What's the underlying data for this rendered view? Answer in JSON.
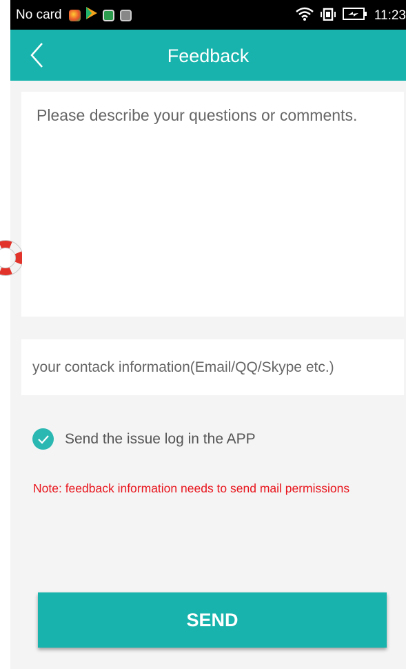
{
  "status_bar": {
    "carrier": "No card",
    "time": "11:23",
    "icons": [
      "app-icon",
      "play-store-icon",
      "app-icon",
      "image-icon",
      "wifi-icon",
      "vibrate-icon",
      "battery-icon"
    ]
  },
  "header": {
    "title": "Feedback",
    "back_icon": "chevron-left-icon"
  },
  "form": {
    "description_placeholder": "Please describe your questions or comments.",
    "description_value": "",
    "contact_placeholder": "your contack information(Email/QQ/Skype etc.)",
    "contact_value": "",
    "send_log_label": "Send the issue log in the APP",
    "send_log_checked": true,
    "note": "Note: feedback information needs to send mail permissions",
    "send_label": "SEND"
  },
  "colors": {
    "accent": "#17b3ac",
    "note_red": "#e8141c",
    "background": "#f4f4f4"
  }
}
